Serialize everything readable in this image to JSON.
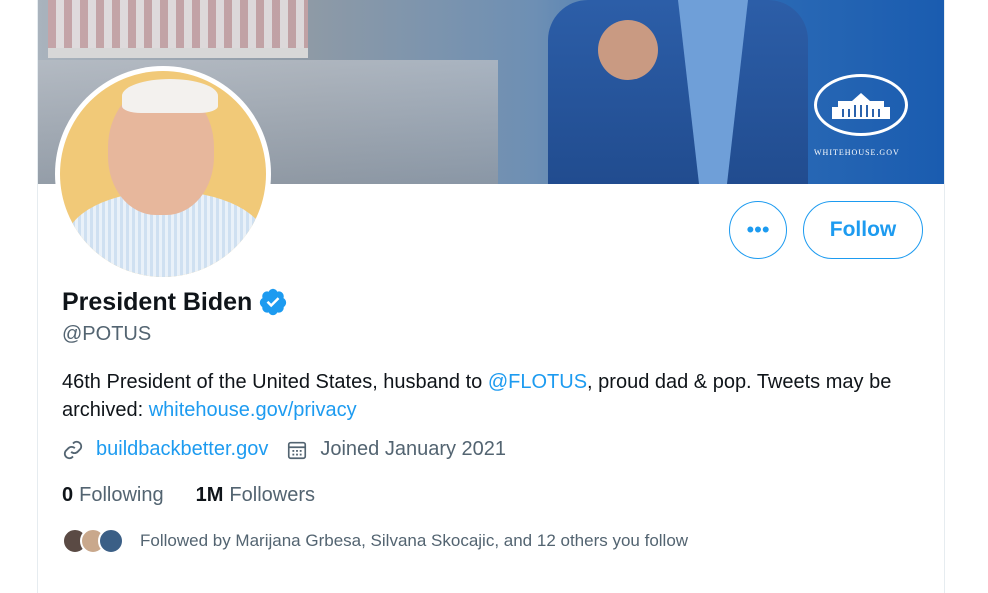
{
  "banner": {
    "watermark": "WHITEHOUSE.GOV"
  },
  "profile": {
    "name": "President Biden",
    "handle": "@POTUS",
    "bio_pre": "46th President of the United States, husband to ",
    "bio_mention": "@FLOTUS",
    "bio_mid": ", proud dad & pop. Tweets may be archived: ",
    "bio_link": "whitehouse.gov/privacy",
    "website": "buildbackbetter.gov",
    "joined": "Joined January 2021"
  },
  "counts": {
    "following_value": "0",
    "following_label": "Following",
    "followers_value": "1M",
    "followers_label": "Followers"
  },
  "followed_by": "Followed by Marijana Grbesa, Silvana Skocajic, and 12 others you follow",
  "buttons": {
    "more": "•••",
    "follow": "Follow"
  },
  "colors": {
    "accent": "#1d9bf0",
    "secondary_text": "#536471"
  },
  "icons": [
    "more-icon",
    "verified-icon",
    "link-icon",
    "calendar-icon"
  ]
}
